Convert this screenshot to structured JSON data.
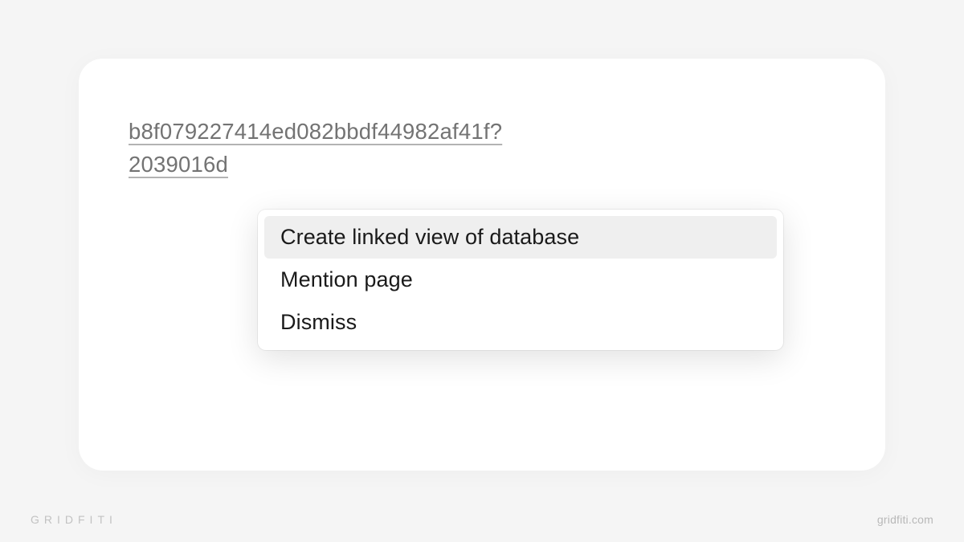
{
  "url": {
    "line1": "b8f079227414ed082bbdf44982af41f?",
    "line2": "2039016d"
  },
  "menu": {
    "items": [
      {
        "label": "Create linked view of database",
        "highlighted": true
      },
      {
        "label": "Mention page",
        "highlighted": false
      },
      {
        "label": "Dismiss",
        "highlighted": false
      }
    ]
  },
  "footer": {
    "brand": "GRIDFITI",
    "site": "gridfiti.com"
  }
}
